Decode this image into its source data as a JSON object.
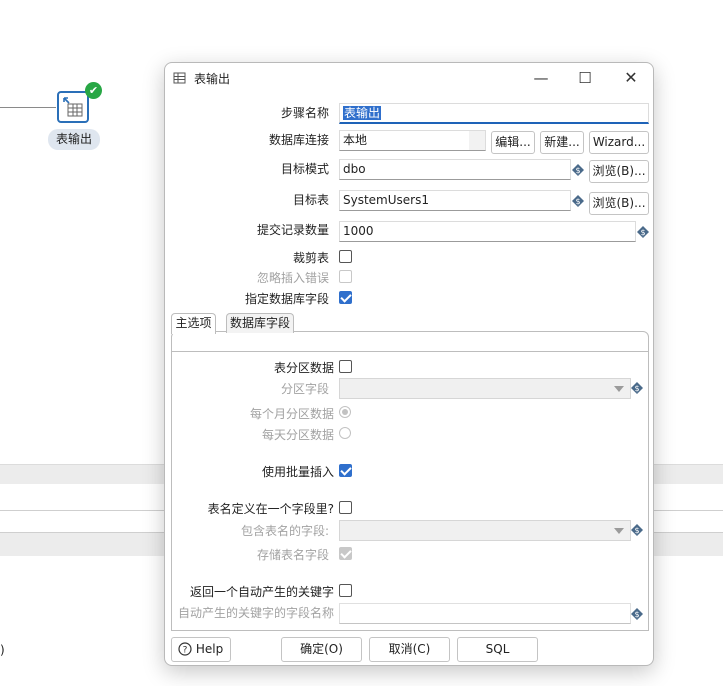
{
  "canvas": {
    "step_label": "表输出",
    "trailing_text": ")"
  },
  "dialog": {
    "title": "表输出",
    "step_name": {
      "label": "步骤名称",
      "value": "表输出"
    },
    "db_connection": {
      "label": "数据库连接",
      "value": "本地",
      "edit": "编辑...",
      "new": "新建...",
      "wizard": "Wizard..."
    },
    "target_schema": {
      "label": "目标模式",
      "value": "dbo",
      "browse": "浏览(B)..."
    },
    "target_table": {
      "label": "目标表",
      "value": "SystemUsers1",
      "browse": "浏览(B)..."
    },
    "commit_size": {
      "label": "提交记录数量",
      "value": "1000"
    },
    "truncate_table": {
      "label": "裁剪表",
      "checked": false
    },
    "ignore_insert_errors": {
      "label": "忽略插入错误",
      "checked": false,
      "enabled": false
    },
    "specify_db_fields": {
      "label": "指定数据库字段",
      "checked": true
    },
    "tabs": [
      {
        "label": "主选项",
        "active": true
      },
      {
        "label": "数据库字段",
        "active": false
      }
    ],
    "main_options": {
      "partition_data": {
        "label": "表分区数据",
        "checked": false
      },
      "partition_field": {
        "label": "分区字段",
        "value": ""
      },
      "monthly_partition": {
        "label": "每个月分区数据",
        "selected": true
      },
      "daily_partition": {
        "label": "每天分区数据",
        "selected": false
      },
      "batch_insert": {
        "label": "使用批量插入",
        "checked": true
      },
      "table_name_in_field": {
        "label": "表名定义在一个字段里?",
        "checked": false
      },
      "table_name_field": {
        "label": "包含表名的字段:",
        "value": ""
      },
      "store_table_name": {
        "label": "存储表名字段",
        "checked": true
      },
      "return_auto_key": {
        "label": "返回一个自动产生的关键字",
        "checked": false
      },
      "auto_key_field": {
        "label": "自动产生的关键字的字段名称",
        "value": ""
      }
    },
    "footer": {
      "help": "Help",
      "ok": "确定(O)",
      "cancel": "取消(C)",
      "sql": "SQL"
    }
  }
}
